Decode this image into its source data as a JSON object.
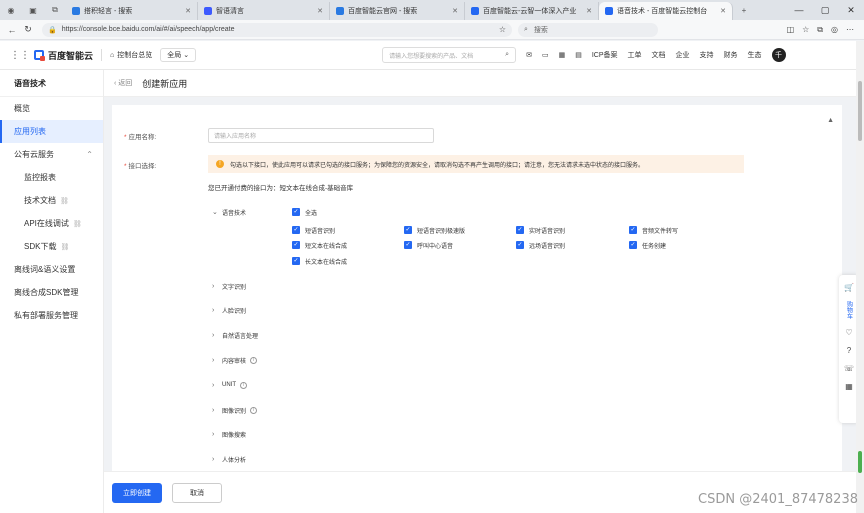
{
  "browser": {
    "tabs": [
      {
        "label": "搭积轻言 - 搜索",
        "color": "#2a7ae2"
      },
      {
        "label": "智语清言",
        "color": "#3d5afe"
      },
      {
        "label": "百度智能云官网 - 搜索",
        "color": "#2a7ae2"
      },
      {
        "label": "百度智能云-云智一体深入产业",
        "color": "#2468f2"
      },
      {
        "label": "语音技术 - 百度智能云控制台",
        "color": "#2468f2"
      }
    ],
    "url": "https://console.bce.baidu.com/ai/#/ai/speech/app/create",
    "search_placeholder": "搜索"
  },
  "topnav": {
    "brand": "百度智能云",
    "console_link": "控制台总览",
    "region": "全局",
    "search_placeholder": "请输入您想要搜索的产品、文档",
    "links": [
      "ICP备案",
      "工单",
      "文档",
      "企业",
      "支持",
      "财务",
      "生态"
    ],
    "avatar_letter": "千"
  },
  "sidebar": {
    "title": "语音技术",
    "items": [
      {
        "label": "概览"
      },
      {
        "label": "应用列表"
      },
      {
        "label": "公有云服务"
      },
      {
        "label": "监控报表"
      },
      {
        "label": "技术文档"
      },
      {
        "label": "API在线调试"
      },
      {
        "label": "SDK下载"
      },
      {
        "label": "离线词&语义设置"
      },
      {
        "label": "离线合成SDK管理"
      },
      {
        "label": "私有部署服务管理"
      }
    ]
  },
  "page": {
    "back": "返回",
    "title": "创建新应用"
  },
  "form": {
    "name_label": "应用名称:",
    "name_placeholder": "请输入应用名称",
    "api_label": "接口选择:",
    "notice": "勾选以下接口，使此应用可以请求已勾选的接口服务；为保障您的资源安全，请取消勾选不再产生调用的接口；请注意，您无法请求未选中状态的接口服务。",
    "opened": "您已开通付费的接口为：短文本在线合成-基础音库",
    "speech_category": "语音技术",
    "select_all": "全选",
    "checkboxes": [
      "短语音识别",
      "短语音识别极速版",
      "实时语音识别",
      "音频文件转写",
      "短文本在线合成",
      "呼叫中心语音",
      "远场语音识别",
      "任务创建",
      "长文本在线合成"
    ],
    "categories": [
      "文字识别",
      "人脸识别",
      "自然语言处理",
      "内容审核",
      "UNIT",
      "图像识别",
      "图像搜索",
      "人体分析"
    ]
  },
  "footer": {
    "create": "立即创建",
    "cancel": "取消"
  },
  "float_panel": {
    "cart": "购物车"
  },
  "watermark": "CSDN @2401_87478238"
}
